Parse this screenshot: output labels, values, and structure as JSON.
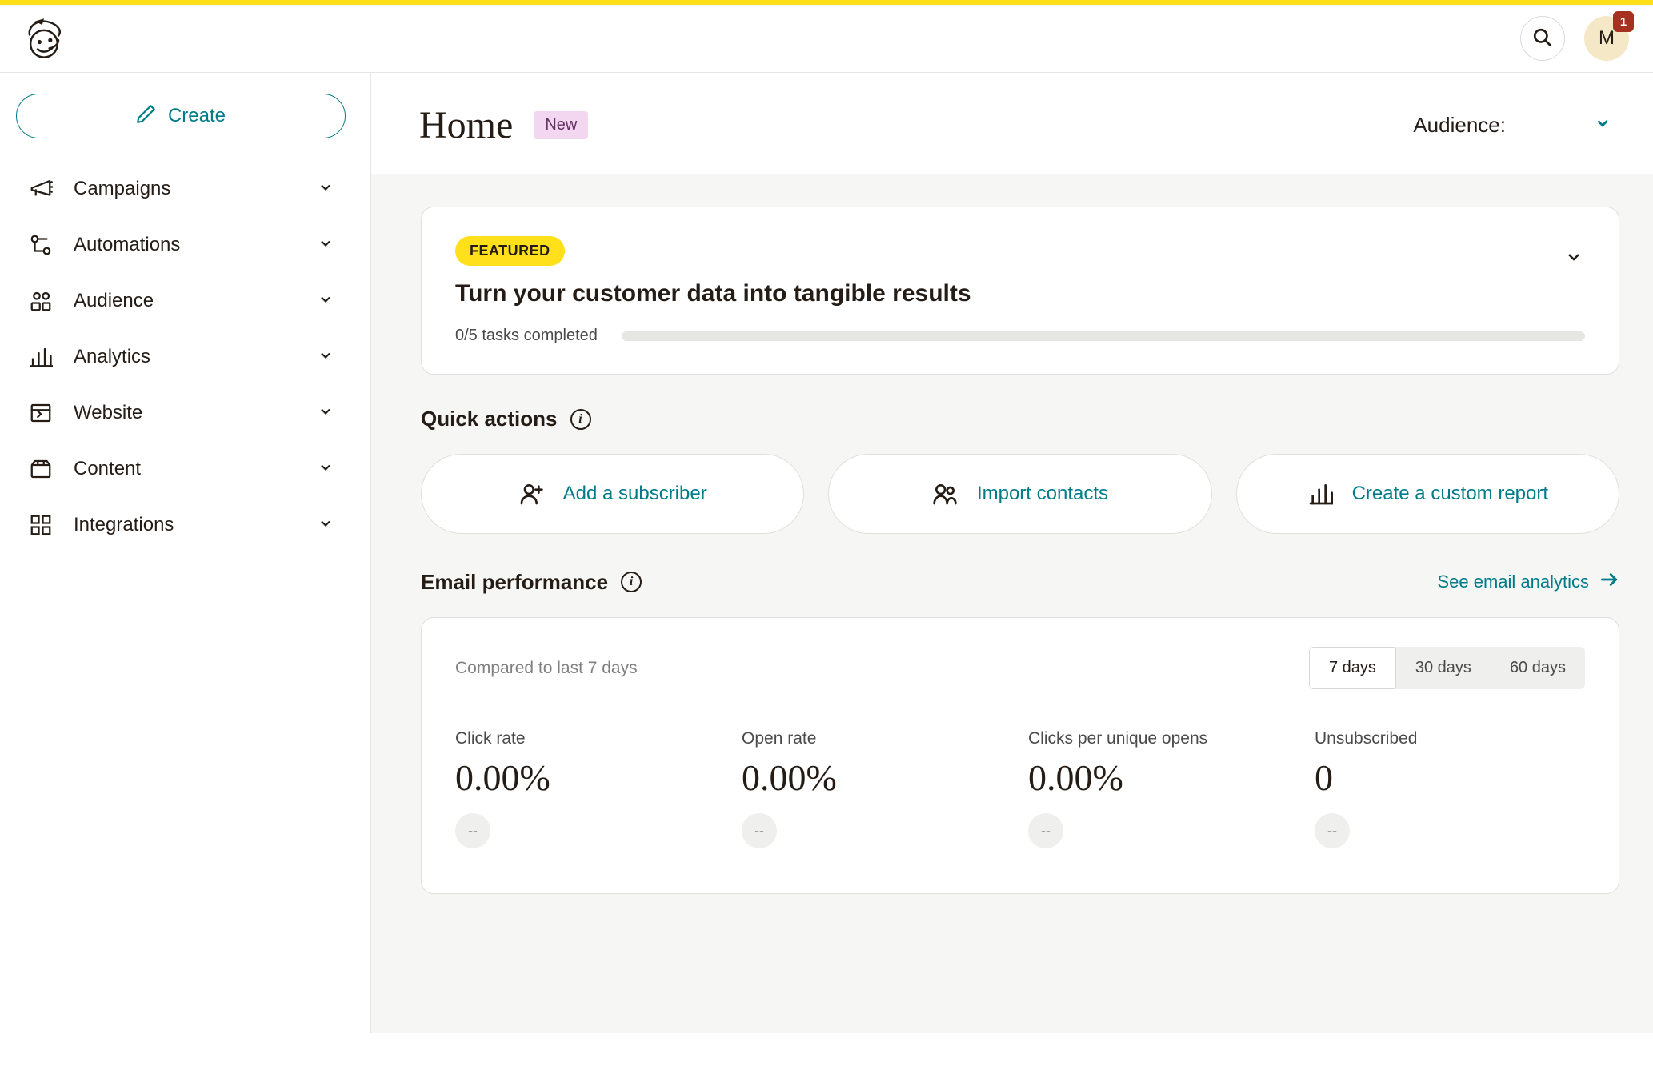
{
  "header": {
    "avatar_initial": "M",
    "badge_count": "1"
  },
  "sidebar": {
    "create_label": "Create",
    "items": [
      {
        "label": "Campaigns"
      },
      {
        "label": "Automations"
      },
      {
        "label": "Audience"
      },
      {
        "label": "Analytics"
      },
      {
        "label": "Website"
      },
      {
        "label": "Content"
      },
      {
        "label": "Integrations"
      }
    ]
  },
  "page": {
    "title": "Home",
    "new_badge": "New",
    "audience_label": "Audience:"
  },
  "featured": {
    "pill": "FEATURED",
    "title": "Turn your customer data into tangible results",
    "progress_text": "0/5 tasks completed"
  },
  "quick_actions": {
    "title": "Quick actions",
    "items": [
      {
        "label": "Add a subscriber"
      },
      {
        "label": "Import contacts"
      },
      {
        "label": "Create a custom report"
      }
    ]
  },
  "email_performance": {
    "title": "Email performance",
    "see_link": "See email analytics",
    "compared_text": "Compared to last 7 days",
    "periods": [
      {
        "label": "7 days",
        "active": true
      },
      {
        "label": "30 days",
        "active": false
      },
      {
        "label": "60 days",
        "active": false
      }
    ],
    "metrics": [
      {
        "label": "Click rate",
        "value": "0.00%",
        "delta": "--"
      },
      {
        "label": "Open rate",
        "value": "0.00%",
        "delta": "--"
      },
      {
        "label": "Clicks per unique opens",
        "value": "0.00%",
        "delta": "--"
      },
      {
        "label": "Unsubscribed",
        "value": "0",
        "delta": "--"
      }
    ]
  }
}
